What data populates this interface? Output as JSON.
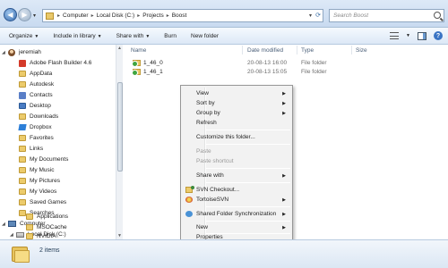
{
  "address": {
    "crumbs": [
      "Computer",
      "Local Disk (C:)",
      "Projects",
      "Boost"
    ],
    "search_placeholder": "Search Boost"
  },
  "toolbar": {
    "organize": "Organize",
    "include_in_library": "Include in library",
    "share_with": "Share with",
    "burn": "Burn",
    "new_folder": "New folder"
  },
  "nav": {
    "items": [
      "jeremiah",
      "Adobe Flash Builder 4.6",
      "AppData",
      "Autodesk",
      "Contacts",
      "Desktop",
      "Downloads",
      "Dropbox",
      "Favorites",
      "Links",
      "My Documents",
      "My Music",
      "My Pictures",
      "My Videos",
      "Saved Games",
      "Searches",
      "Computer",
      "Local Disk (C:)",
      "Applications",
      "MSOCache",
      "NVIDIA"
    ]
  },
  "files": {
    "columns": {
      "name": "Name",
      "date": "Date modified",
      "type": "Type",
      "size": "Size"
    },
    "rows": [
      {
        "name": "1_46_0",
        "date": "20-08-13 16:00",
        "type": "File folder"
      },
      {
        "name": "1_46_1",
        "date": "20-08-13 15:05",
        "type": "File folder"
      }
    ]
  },
  "context_menu": {
    "items": [
      {
        "label": "View",
        "submenu": true
      },
      {
        "label": "Sort by",
        "submenu": true
      },
      {
        "label": "Group by",
        "submenu": true
      },
      {
        "label": "Refresh"
      },
      {
        "label": "Customize this folder..."
      },
      {
        "label": "Paste",
        "disabled": true
      },
      {
        "label": "Paste shortcut",
        "disabled": true
      },
      {
        "label": "Share with",
        "submenu": true
      },
      {
        "label": "SVN Checkout..."
      },
      {
        "label": "TortoiseSVN",
        "submenu": true
      },
      {
        "label": "Shared Folder Synchronization",
        "submenu": true
      },
      {
        "label": "New",
        "submenu": true
      },
      {
        "label": "Properties"
      }
    ]
  },
  "status": {
    "item_count": "2 items"
  }
}
